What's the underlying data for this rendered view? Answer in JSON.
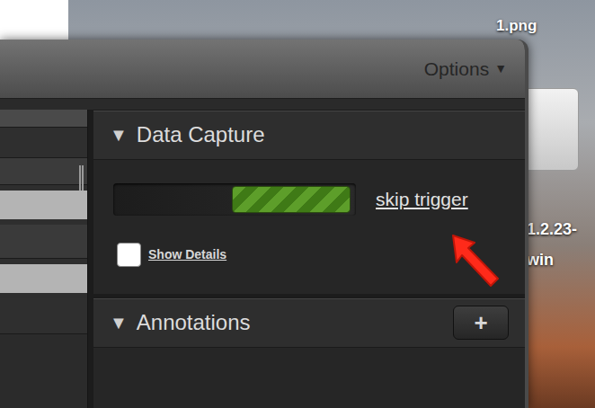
{
  "desktop": {
    "icons": [
      {
        "lines": [
          "1.png"
        ]
      },
      {
        "lines": [
          "1.2.23-",
          "win"
        ]
      }
    ]
  },
  "window": {
    "menu": {
      "label": "Options",
      "icon": "▼"
    }
  },
  "data_capture": {
    "toggle": "▼",
    "title": "Data Capture",
    "expanded": true,
    "progress": {
      "level": 0.5
    },
    "link": "skip trigger",
    "show_details": {
      "label": "Show Details",
      "checked": false
    }
  },
  "annotations": {
    "toggle": "▼",
    "title": "Annotations",
    "expanded": true,
    "add_button": "+"
  }
}
